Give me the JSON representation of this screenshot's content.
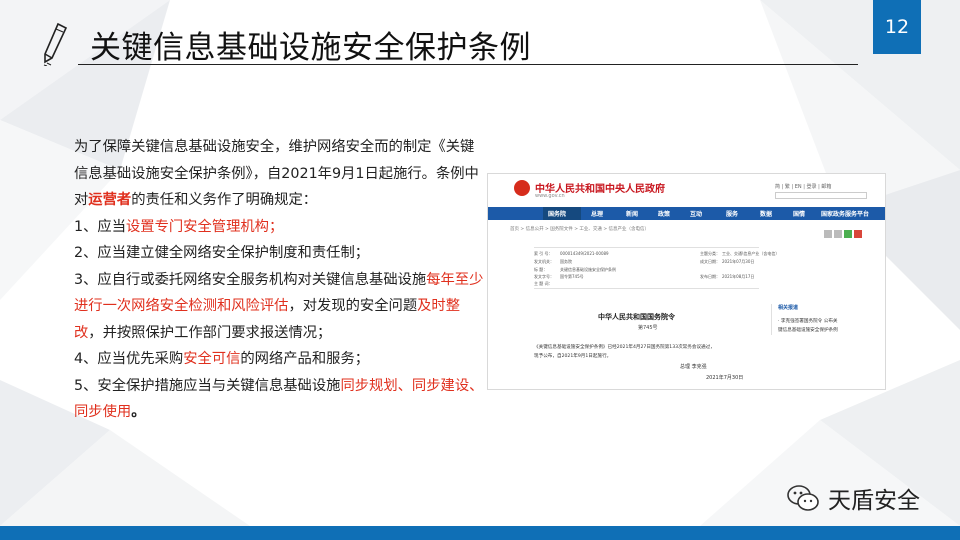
{
  "slide": {
    "title": "关键信息基础设施安全保护条例",
    "page_number": "12",
    "brand_color": "#0f6fb6",
    "highlight_color": "#e0301e",
    "watermark": "天盾安全"
  },
  "body": {
    "p1_a": "为了保障关键信息基础设施安全，维护网络安全而的制定《关键信息基础设施安全保护条例》，自2021年9月1日起施行。条例中对",
    "p1_red": "运营者",
    "p1_b": "的责任和义务作了明确规定：",
    "item1_a": "1、应当",
    "item1_red": "设置专门安全管理机构；",
    "item2": "2、应当建立健全网络安全保护制度和责任制；",
    "item3_a": "3、应自行或委托网络安全服务机构对关键信息基础设施",
    "item3_red1": "每年至少进行一次网络安全检测和风险评估",
    "item3_b": "，对发现的安全问题",
    "item3_red2": "及时整改",
    "item3_c": "，并按照保护工作部门要求报送情况；",
    "item4_a": "4、应当优先采购",
    "item4_red": "安全可信",
    "item4_b": "的网络产品和服务；",
    "item5_a": "5、安全保护措施应当与关键信息基础设施",
    "item5_red": "同步规划、同步建设、同步使用",
    "item5_b": "。"
  },
  "screenshot": {
    "site_title": "中华人民共和国中央人民政府",
    "site_url": "www.gov.cn",
    "top_links": "简 | 繁 | EN | 登录 | 邮箱",
    "nav": [
      "国务院",
      "总理",
      "新闻",
      "政策",
      "互动",
      "服务",
      "数据",
      "国情",
      "国家政务服务平台"
    ],
    "breadcrumb": "首页 > 信息公开 > 国务院文件 > 工业、交通 > 信息产业（含电信）",
    "meta": {
      "index_label": "索 引 号：",
      "index_value": "000014349/2021-00089",
      "issuer_label": "发文机关：",
      "issuer_value": "国务院",
      "title_label": "标    题：",
      "title_value": "关键信息基础设施安全保护条例",
      "number_label": "发文字号：",
      "number_value": "国令第745号",
      "topic_label": "主 题 词：",
      "topic_value": "",
      "category_label": "主题分类：",
      "category_value": "工业、交通\\信息产业（含电信）",
      "written_label": "成文日期：",
      "written_value": "2021年07月30日",
      "published_label": "发布日期：",
      "published_value": "2021年08月17日"
    },
    "doc_title": "中华人民共和国国务院令",
    "doc_number": "第745号",
    "doc_body_line1": "《关键信息基础设施安全保护条例》已经2021年4月27日国务院第133次常务会议通过，",
    "doc_body_line2": "现予公布，自2021年9月1日起施行。",
    "sign": "总理    李克强",
    "date": "2021年7月30日",
    "related_heading": "相关报道",
    "related_item1": "· 李克强签署国务院令 公布关",
    "related_item2": "键信息基础设施安全保护条例"
  }
}
